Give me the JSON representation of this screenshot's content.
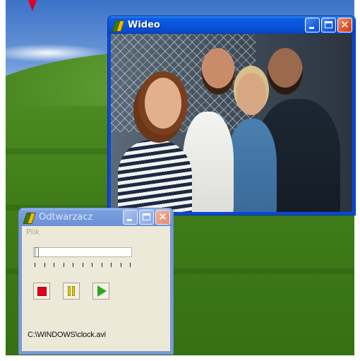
{
  "video_window": {
    "title": "Wideo"
  },
  "player_window": {
    "title": "Odtwarzacz",
    "menu": [
      "Plik"
    ],
    "seek_position": 0.0,
    "file_path": "C:\\WINDOWS\\clock.avi"
  },
  "colors": {
    "titlebar_active": "#0a55dc",
    "titlebar_inactive": "#7197dc",
    "window_face": "#ece9d8",
    "stop": "#e8001a",
    "pause": "#f2d200",
    "play": "#2ea51a",
    "cursor_arrow": "#e5002a"
  },
  "icons": {
    "app": "app-logo-icon",
    "minimize": "minimize-icon",
    "maximize": "maximize-icon",
    "close": "close-icon",
    "stop": "stop-icon",
    "pause": "pause-icon",
    "play": "play-icon"
  }
}
